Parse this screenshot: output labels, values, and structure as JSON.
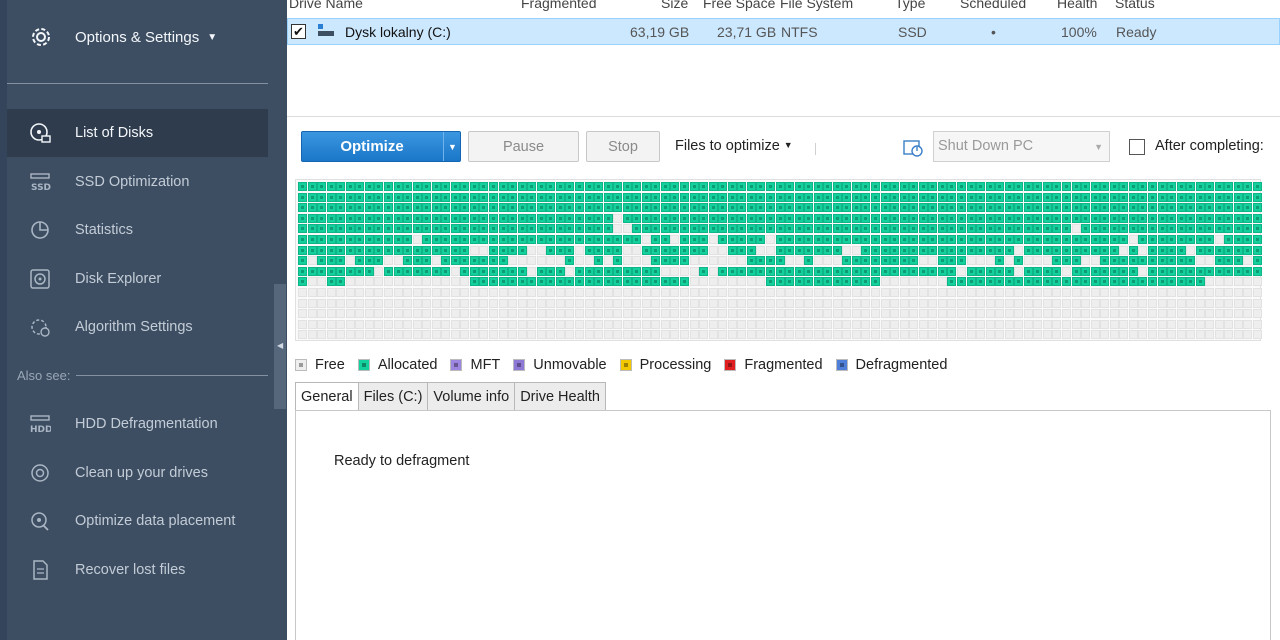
{
  "sidebar": {
    "options_label": "Options & Settings",
    "nav": [
      {
        "label": "List of Disks",
        "icon": "disk-list-icon",
        "active": true
      },
      {
        "label": "SSD Optimization",
        "icon": "ssd-icon"
      },
      {
        "label": "Statistics",
        "icon": "pie-chart-icon"
      },
      {
        "label": "Disk Explorer",
        "icon": "disk-explorer-icon"
      },
      {
        "label": "Algorithm Settings",
        "icon": "algorithm-settings-icon"
      }
    ],
    "also_see_label": "Also see:",
    "also_see": [
      {
        "label": "HDD Defragmentation",
        "icon": "hdd-icon"
      },
      {
        "label": "Clean up your drives",
        "icon": "cleanup-disc-icon"
      },
      {
        "label": "Optimize data placement",
        "icon": "optimize-placement-icon"
      },
      {
        "label": "Recover lost files",
        "icon": "recover-files-icon"
      }
    ]
  },
  "drives": {
    "columns": [
      "Drive Name",
      "Fragmented",
      "Size",
      "Free Space",
      "File System",
      "Type",
      "Scheduled",
      "Health",
      "Status"
    ],
    "rows": [
      {
        "checked": true,
        "name": "Dysk lokalny (C:)",
        "fragmented": "",
        "size": "63,19 GB",
        "free_space": "23,71 GB",
        "file_system": "NTFS",
        "type": "SSD",
        "scheduled": "•",
        "health": "100%",
        "status": "Ready"
      }
    ]
  },
  "toolbar": {
    "optimize_label": "Optimize",
    "pause_label": "Pause",
    "stop_label": "Stop",
    "files_to_optimize_label": "Files to optimize",
    "shutdown_select_value": "Shut Down PC",
    "after_completing_label": "After completing:"
  },
  "legend": [
    {
      "label": "Free",
      "color": "#eeeeee"
    },
    {
      "label": "Allocated",
      "color": "#14d09c"
    },
    {
      "label": "MFT",
      "color": "#9c86e0"
    },
    {
      "label": "Unmovable",
      "color": "#8e7ad6"
    },
    {
      "label": "Processing",
      "color": "#f2c800"
    },
    {
      "label": "Fragmented",
      "color": "#e02020"
    },
    {
      "label": "Defragmented",
      "color": "#4f7fd8"
    }
  ],
  "tabs": [
    "General",
    "Files (C:)",
    "Volume info",
    "Drive Health"
  ],
  "general_status": "Ready to defragment",
  "disk_map": {
    "rows": [
      "11111111111111111111111111111111111111111111111111111111111111111111111111111111111111111111111111111",
      "11111111111111111111111111111111111111111111111111111111111111111111111111111111111111111111111111111",
      "11111111111111111111111111111111111111111111111111111111111111111111111111111111111111111111111111111",
      "11111111111111111111111111111111101111111111111111111111111111111111111111111111111111111111111111111",
      "11111111111111111111111111111111100111111111111111111111111111111111111111111111101111111111111111111",
      "11111111111101111111111111111111111101101110111110111111111111111111111111111111111111101111111101111",
      "11111111111111111100111100111011110011111110011100111111100111111111111111101111111111010111101111111",
      "10111011100111011111110000001001010001111000000111100100011111111001110001010001110011111111110011101",
      "11111111011111110111111101110111111111000010111111111111111111111111101111101111011111110111111111111",
      "10011000000000000011111111111111111111111000000001111111111110000000111111111111111111111111111000000",
      "00000000000000000000000000000000000000000000000000000000000000000000000000000000000000000000000000000",
      "00000000000000000000000000000000000000000000000000000000000000000000000000000000000000000000000000000",
      "00000000000000000000000000000000000000000000000000000000000000000000000000000000000000000000000000000",
      "00000000000000000000000000000000000000000000000000000000000000000000000000000000000000000000000000000",
      "00000000000000000000000000000000000000000000000000000000000000000000000000000000000000000000000000000"
    ]
  }
}
